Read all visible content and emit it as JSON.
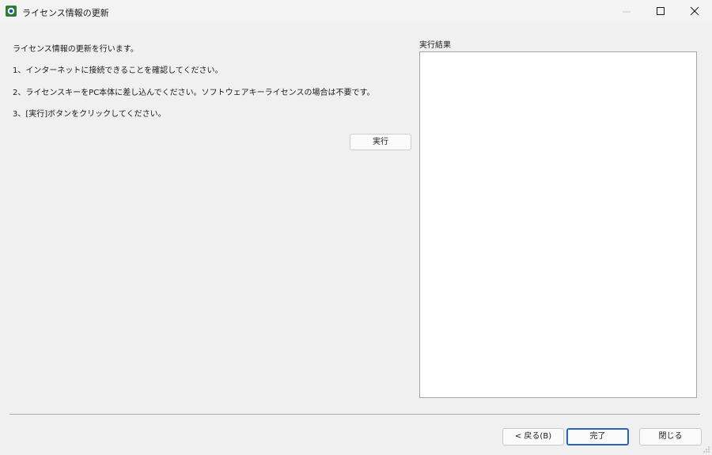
{
  "window": {
    "title": "ライセンス情報の更新",
    "icon": "app-logo-icon",
    "controls": [
      "minimize-icon",
      "maximize-icon",
      "close-icon"
    ]
  },
  "instructions": {
    "intro": "ライセンス情報の更新を行います。",
    "steps": [
      "1、インターネットに接続できることを確認してください。",
      "2、ライセンスキーをPC本体に差し込んでください。ソフトウェアキーライセンスの場合は不要です。",
      "3、[実行]ボタンをクリックしてください。"
    ]
  },
  "execute_label": "実行",
  "result": {
    "label": "実行結果",
    "value": ""
  },
  "footer": {
    "back_label": "< 戻る(B)",
    "finish_label": "完了",
    "close_label": "閉じる"
  },
  "colors": {
    "window_bg": "#f0f0f0",
    "default_button_border": "#2a64b8"
  }
}
